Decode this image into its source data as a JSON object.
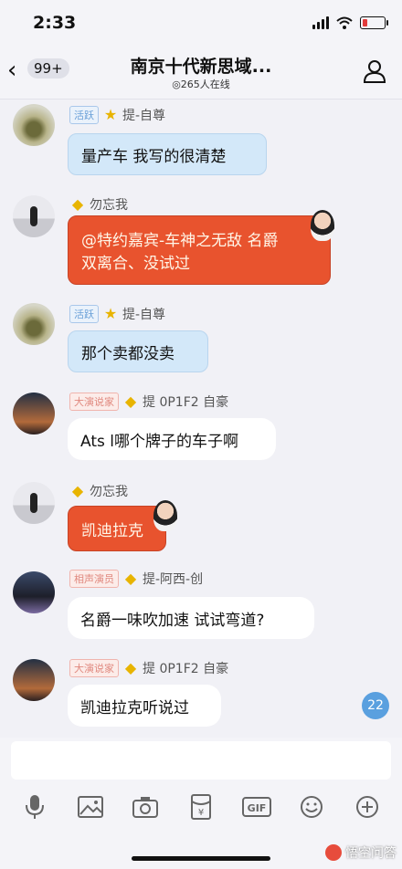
{
  "status_bar": {
    "time": "2:33"
  },
  "header": {
    "unread_count": "99+",
    "title": "南京十代新思域...",
    "online": "265人在线"
  },
  "messages": [
    {
      "sender": "提-自尊",
      "tag": "活跃",
      "text": "量产车 我写的很清楚"
    },
    {
      "sender": "勿忘我",
      "line1": "@特约嘉宾-车神之无敌 名爵",
      "line2": "双离合、没试过"
    },
    {
      "sender": "提-自尊",
      "tag": "活跃",
      "text": "那个卖都没卖"
    },
    {
      "sender": "提 0P1F2 自豪",
      "tag": "大演说家",
      "text": "Ats l哪个牌子的车子啊"
    },
    {
      "sender": "勿忘我",
      "text": "凯迪拉克"
    },
    {
      "sender": "提-阿西-创",
      "tag": "相声演员",
      "text": "名爵一味吹加速 试试弯道?"
    },
    {
      "sender": "提 0P1F2 自豪",
      "tag": "大演说家",
      "text": "凯迪拉克听说过"
    }
  ],
  "new_message_badge": "22",
  "input": {
    "placeholder": ""
  },
  "toolbar": [
    "mic-icon",
    "image-icon",
    "camera-icon",
    "red-packet-icon",
    "gif-icon",
    "emoji-icon",
    "plus-icon"
  ],
  "watermark": "悟空问答"
}
